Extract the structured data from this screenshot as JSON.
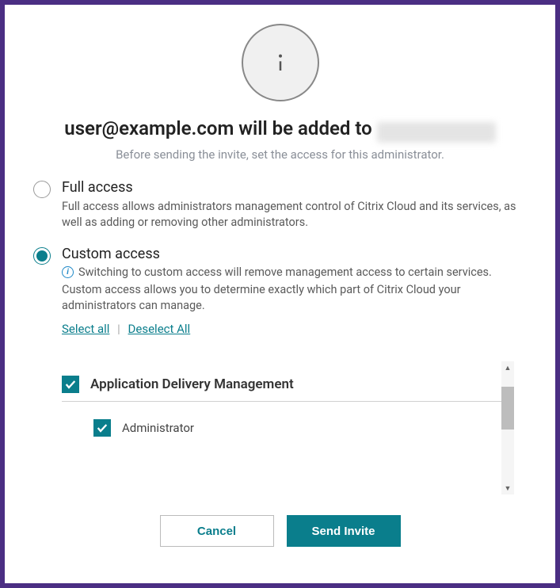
{
  "title_prefix": "user@example.com will be added to",
  "subtitle": "Before sending the invite, set the access for this administrator.",
  "options": {
    "full": {
      "title": "Full access",
      "desc": "Full access allows administrators management control of Citrix Cloud and its services, as well as adding or removing other administrators."
    },
    "custom": {
      "title": "Custom access",
      "info": "Switching to custom access will remove management access to certain services.",
      "desc": "Custom access allows you to determine exactly which part of Citrix Cloud your administrators can manage.",
      "select_all": "Select all",
      "deselect_all": "Deselect All"
    }
  },
  "services": [
    {
      "name": "Application Delivery Management",
      "checked": true,
      "roles": [
        {
          "name": "Administrator",
          "checked": true
        }
      ]
    }
  ],
  "buttons": {
    "cancel": "Cancel",
    "send": "Send Invite"
  }
}
